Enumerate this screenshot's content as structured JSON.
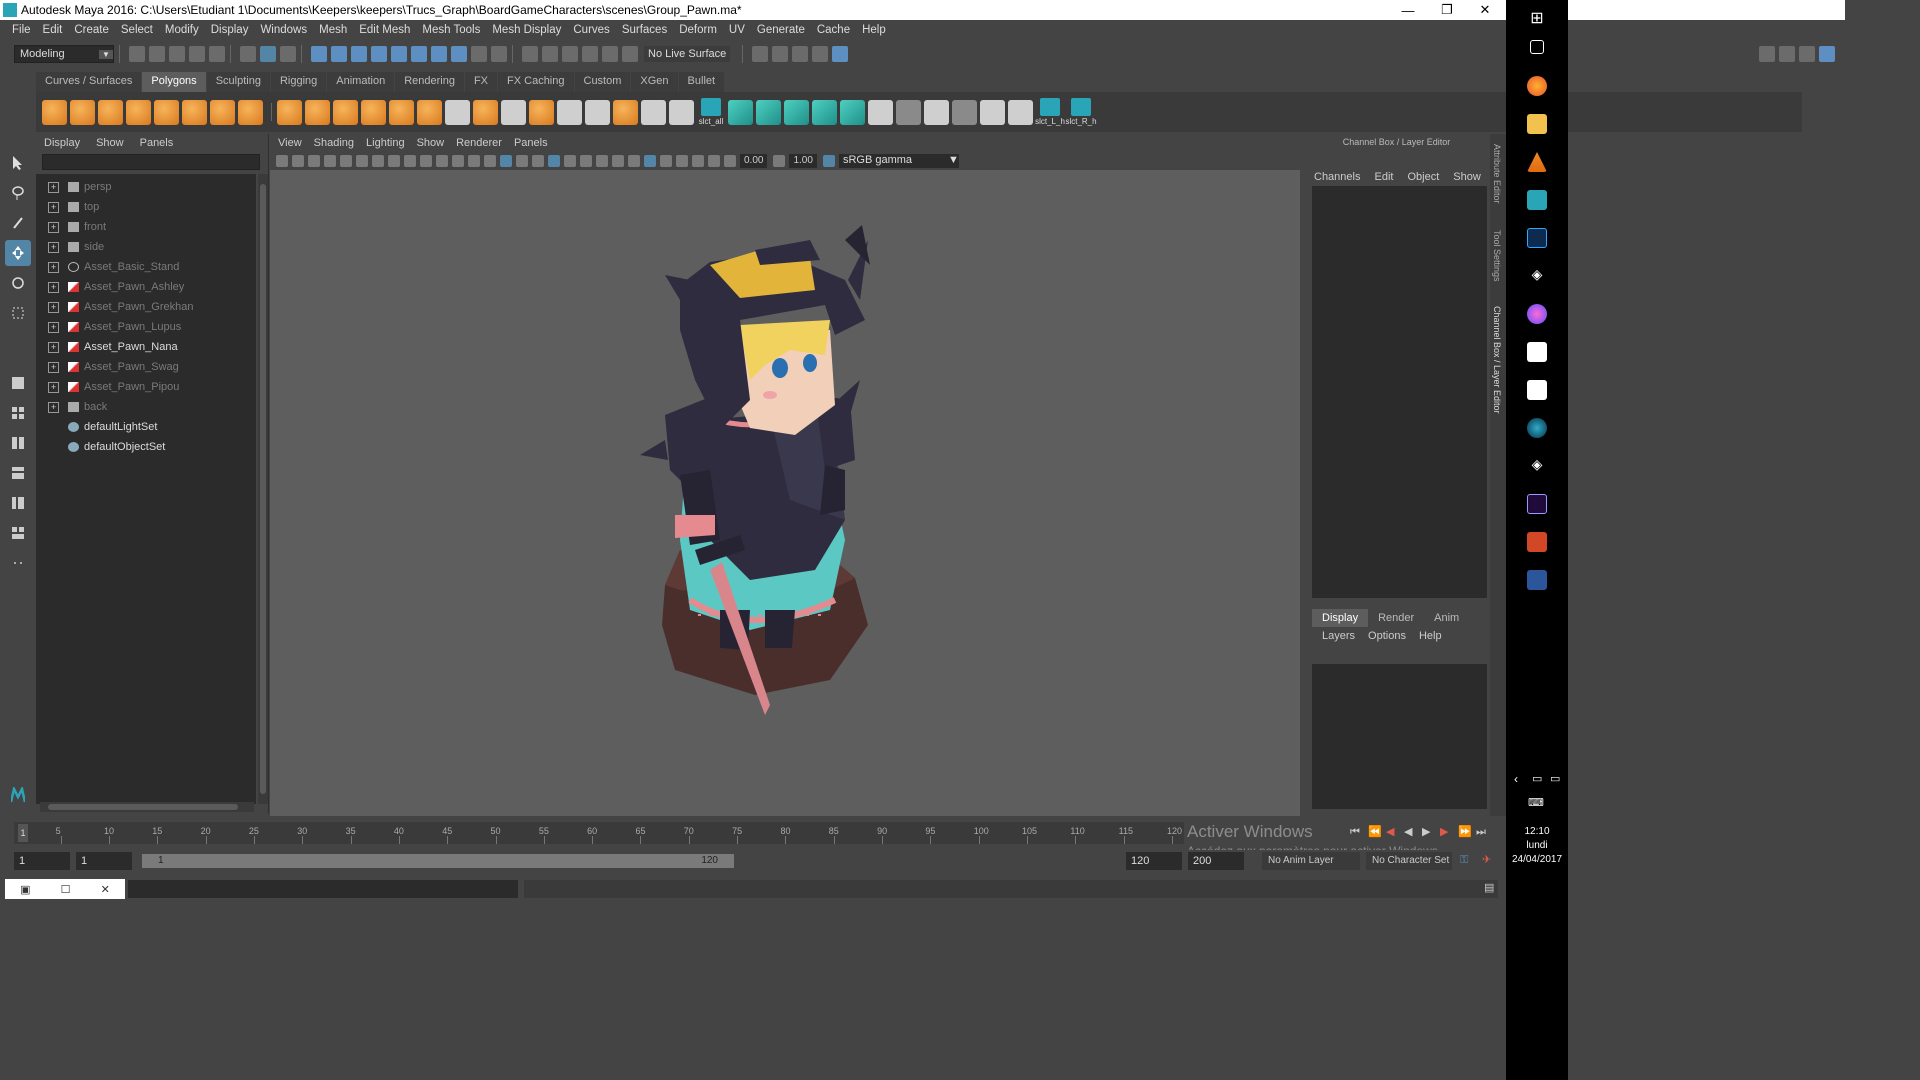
{
  "window": {
    "title": "Autodesk Maya 2016: C:\\Users\\Etudiant 1\\Documents\\Keepers\\keepers\\Trucs_Graph\\BoardGameCharacters\\scenes\\Group_Pawn.ma*",
    "minimize": "—",
    "restore": "❐",
    "close": "✕"
  },
  "menubar": [
    "File",
    "Edit",
    "Create",
    "Select",
    "Modify",
    "Display",
    "Windows",
    "Mesh",
    "Edit Mesh",
    "Mesh Tools",
    "Mesh Display",
    "Curves",
    "Surfaces",
    "Deform",
    "UV",
    "Generate",
    "Cache",
    "Help"
  ],
  "statusline": {
    "mode": "Modeling",
    "live_surface": "No Live Surface"
  },
  "shelf": {
    "tabs": [
      "Curves / Surfaces",
      "Polygons",
      "Sculpting",
      "Rigging",
      "Animation",
      "Rendering",
      "FX",
      "FX Caching",
      "Custom",
      "XGen",
      "Bullet"
    ],
    "active_tab": "Polygons",
    "labels": [
      "slct_all",
      "slct_L_h",
      "slct_R_h"
    ]
  },
  "outliner": {
    "menu": [
      "Display",
      "Show",
      "Panels"
    ],
    "items": [
      {
        "label": "persp",
        "icon": "camera-icon",
        "state": "dim"
      },
      {
        "label": "top",
        "icon": "camera-icon",
        "state": "dim"
      },
      {
        "label": "front",
        "icon": "camera-icon",
        "state": "dim"
      },
      {
        "label": "side",
        "icon": "camera-icon",
        "state": "dim"
      },
      {
        "label": "Asset_Basic_Stand",
        "icon": "group-icon",
        "state": "dim"
      },
      {
        "label": "Asset_Pawn_Ashley",
        "icon": "mesh-icon",
        "state": "dim"
      },
      {
        "label": "Asset_Pawn_Grekhan",
        "icon": "mesh-icon",
        "state": "dim"
      },
      {
        "label": "Asset_Pawn_Lupus",
        "icon": "mesh-icon",
        "state": "dim"
      },
      {
        "label": "Asset_Pawn_Nana",
        "icon": "mesh-icon",
        "state": "lit"
      },
      {
        "label": "Asset_Pawn_Swag",
        "icon": "mesh-icon",
        "state": "dim"
      },
      {
        "label": "Asset_Pawn_Pipou",
        "icon": "mesh-icon",
        "state": "dim"
      },
      {
        "label": "back",
        "icon": "camera-icon",
        "state": "dim"
      },
      {
        "label": "defaultLightSet",
        "icon": "set-icon",
        "state": "lit"
      },
      {
        "label": "defaultObjectSet",
        "icon": "set-icon",
        "state": "lit"
      }
    ]
  },
  "viewport": {
    "menu": [
      "View",
      "Shading",
      "Lighting",
      "Show",
      "Renderer",
      "Panels"
    ],
    "exposure": "0.00",
    "gamma_value": "1.00",
    "color_space": "sRGB gamma"
  },
  "channel_box": {
    "title": "Channel Box / Layer Editor",
    "menu": [
      "Channels",
      "Edit",
      "Object",
      "Show"
    ],
    "tabs": [
      "Display",
      "Render",
      "Anim"
    ],
    "active_tab": "Display",
    "layer_menu": [
      "Layers",
      "Options",
      "Help"
    ],
    "side_tabs": [
      "Attribute Editor",
      "Tool Settings",
      "Channel Box / Layer Editor"
    ]
  },
  "timeline": {
    "ticks": [
      "5",
      "10",
      "15",
      "20",
      "25",
      "30",
      "35",
      "40",
      "45",
      "50",
      "55",
      "60",
      "65",
      "70",
      "75",
      "80",
      "85",
      "90",
      "95",
      "100",
      "105",
      "110",
      "115",
      "120"
    ],
    "current_frame": "1",
    "range_start": "1",
    "range_inner_start": "1",
    "range_bar_start": "1",
    "range_bar_end": "120",
    "range_end": "120",
    "anim_end": "200",
    "anim_layer": "No Anim Layer",
    "char_set": "No Character Set"
  },
  "watermark": {
    "line1": "Activer Windows",
    "line2": "Accédez aux paramètres pour activer Windows."
  },
  "taskbar": {
    "time": "12:10",
    "day": "lundi",
    "date": "24/04/2017"
  },
  "colors": {
    "accent": "#5285a6",
    "maya_teal": "#2aa5b8",
    "viewport_bg": "#5e5e5e"
  }
}
